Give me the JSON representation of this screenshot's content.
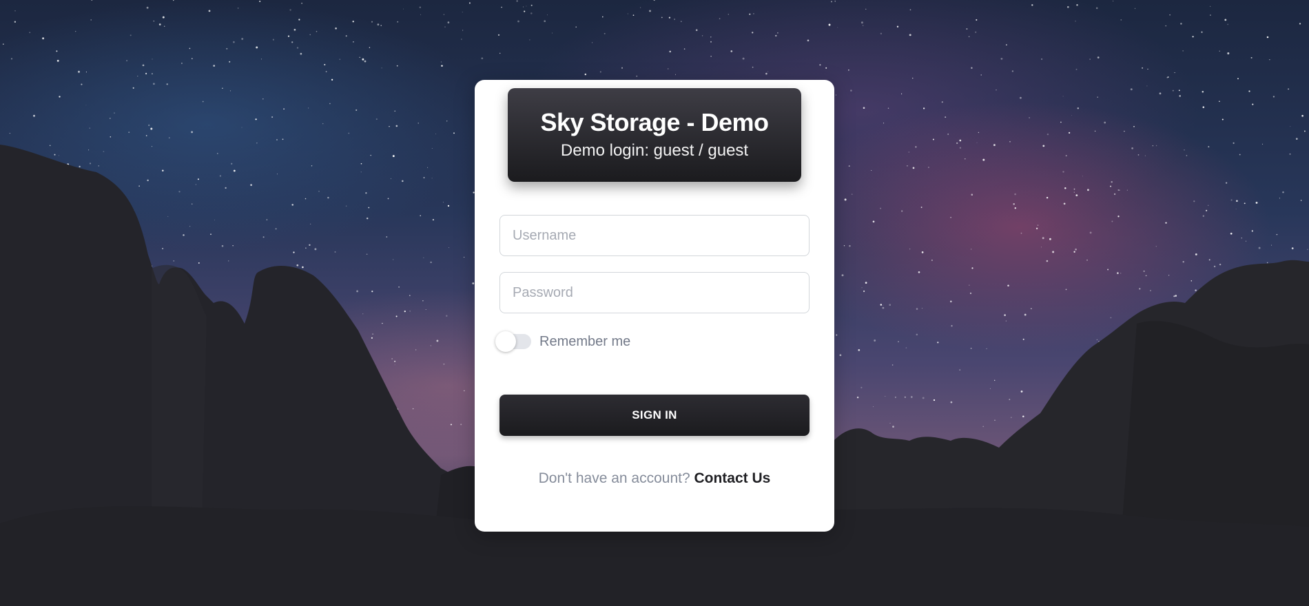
{
  "login": {
    "title": "Sky Storage - Demo",
    "subtitle": "Demo login: guest / guest",
    "username_placeholder": "Username",
    "password_placeholder": "Password",
    "remember_label": "Remember me",
    "remember_checked": false,
    "signin_label": "SIGN IN",
    "footer_prefix": "Don't have an account?",
    "footer_link": "Contact Us"
  },
  "colors": {
    "card_background": "#ffffff",
    "header_gradient_top": "#3e3d45",
    "header_gradient_bottom": "#1b1b1e",
    "button_background": "#1f1f23",
    "muted_text": "#858c9a"
  }
}
